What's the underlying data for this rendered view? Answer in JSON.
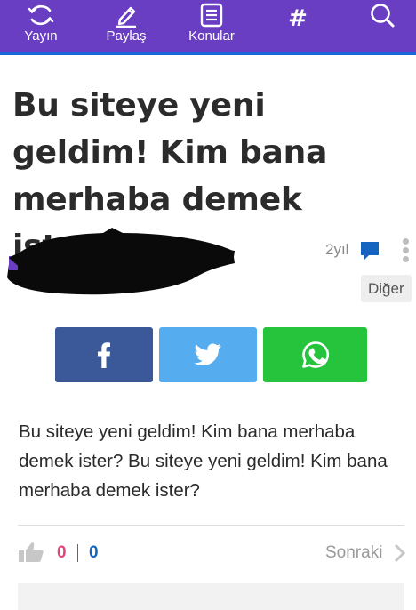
{
  "nav": {
    "items": [
      {
        "label": "Yayın",
        "icon": "refresh-circle-icon"
      },
      {
        "label": "Paylaş",
        "icon": "pencil-icon"
      },
      {
        "label": "Konular",
        "icon": "document-list-icon"
      },
      {
        "label": "",
        "icon": "hashtag-icon",
        "glyph": "#"
      },
      {
        "label": "",
        "icon": "search-icon"
      }
    ],
    "bar_color": "#6a3ec2",
    "accent_line_color": "#1a67d6"
  },
  "post": {
    "title": "Bu siteye yeni geldim! Kim bana merhaba demek ister?",
    "age": "2yıl",
    "category": "Diğer",
    "body": "Bu siteye yeni geldim! Kim bana merhaba demek ister? Bu siteye yeni geldim! Kim bana merhaba demek ister?",
    "likes": "0",
    "dislikes": "0",
    "next_label": "Sonraki"
  },
  "share": {
    "facebook_color": "#3b5998",
    "twitter_color": "#55acee",
    "whatsapp_color": "#25c43c"
  }
}
